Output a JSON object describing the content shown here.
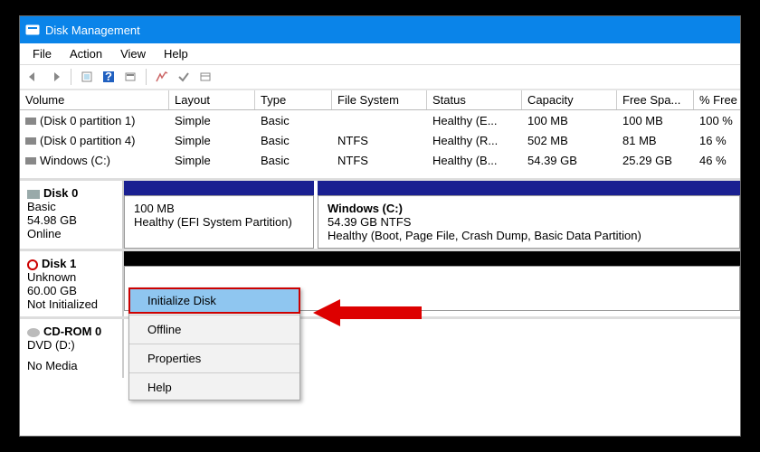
{
  "title": "Disk Management",
  "menu": {
    "file": "File",
    "action": "Action",
    "view": "View",
    "help": "Help"
  },
  "columns": {
    "volume": "Volume",
    "layout": "Layout",
    "type": "Type",
    "fs": "File System",
    "status": "Status",
    "capacity": "Capacity",
    "freespace": "Free Spa...",
    "pctfree": "% Free"
  },
  "volumes": [
    {
      "name": "(Disk 0 partition 1)",
      "layout": "Simple",
      "type": "Basic",
      "fs": "",
      "status": "Healthy (E...",
      "capacity": "100 MB",
      "free": "100 MB",
      "pct": "100 %"
    },
    {
      "name": "(Disk 0 partition 4)",
      "layout": "Simple",
      "type": "Basic",
      "fs": "NTFS",
      "status": "Healthy (R...",
      "capacity": "502 MB",
      "free": "81 MB",
      "pct": "16 %"
    },
    {
      "name": "Windows (C:)",
      "layout": "Simple",
      "type": "Basic",
      "fs": "NTFS",
      "status": "Healthy (B...",
      "capacity": "54.39 GB",
      "free": "25.29 GB",
      "pct": "46 %"
    }
  ],
  "disk0": {
    "label": "Disk 0",
    "type": "Basic",
    "size": "54.98 GB",
    "state": "Online",
    "part1": {
      "size": "100 MB",
      "desc": "Healthy (EFI System Partition)"
    },
    "part2": {
      "name": "Windows  (C:)",
      "size": "54.39 GB NTFS",
      "desc": "Healthy (Boot, Page File, Crash Dump, Basic Data Partition)"
    }
  },
  "disk1": {
    "label": "Disk 1",
    "type": "Unknown",
    "size": "60.00 GB",
    "state": "Not Initialized"
  },
  "cdrom": {
    "label": "CD-ROM 0",
    "type": "DVD (D:)",
    "state": "No Media"
  },
  "ctx": {
    "init": "Initialize Disk",
    "offline": "Offline",
    "props": "Properties",
    "help": "Help"
  }
}
